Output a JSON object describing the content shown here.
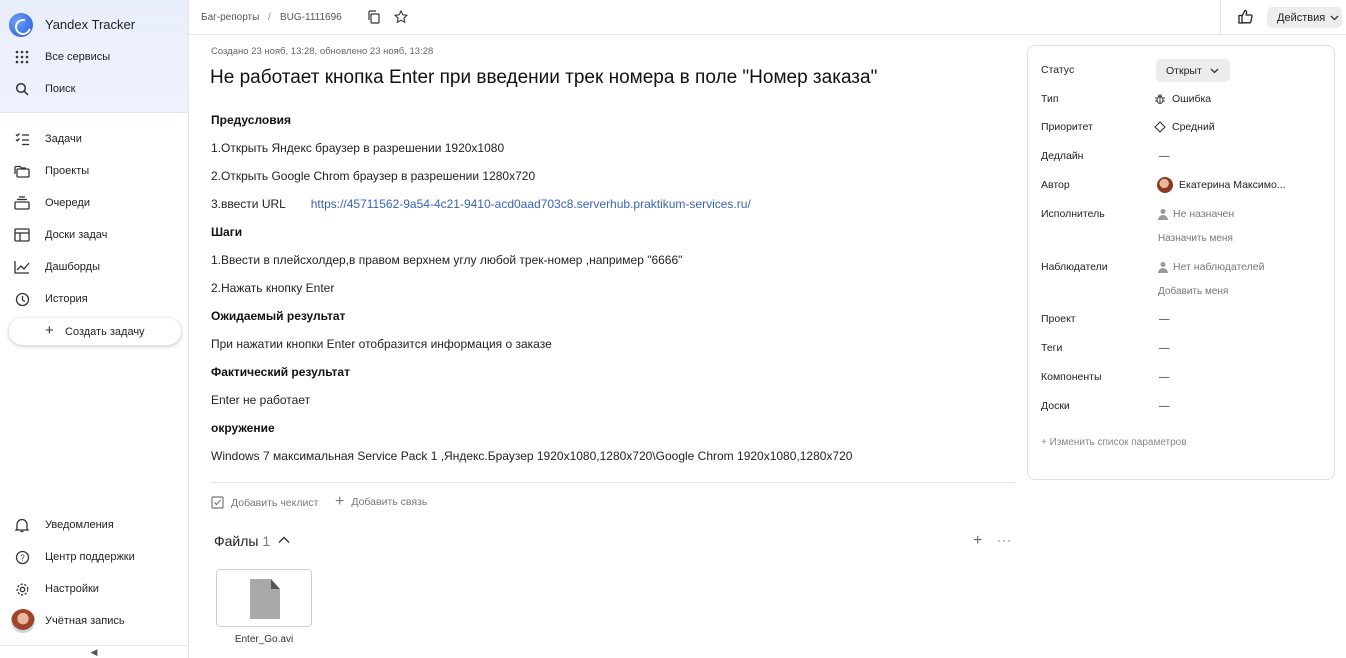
{
  "sidebar": {
    "brand": "Yandex Tracker",
    "top_items": [
      {
        "label": "Все сервисы",
        "icon": "grid-icon"
      },
      {
        "label": "Поиск",
        "icon": "search-icon"
      }
    ],
    "nav_items": [
      {
        "label": "Задачи",
        "icon": "tasks-icon"
      },
      {
        "label": "Проекты",
        "icon": "projects-icon"
      },
      {
        "label": "Очереди",
        "icon": "queues-icon"
      },
      {
        "label": "Доски задач",
        "icon": "boards-icon"
      },
      {
        "label": "Дашборды",
        "icon": "dashboards-icon"
      },
      {
        "label": "История",
        "icon": "history-icon"
      }
    ],
    "create_task": "Создать задачу",
    "bottom_items": [
      {
        "label": "Уведомления",
        "icon": "bell-icon"
      },
      {
        "label": "Центр поддержки",
        "icon": "help-icon"
      },
      {
        "label": "Настройки",
        "icon": "gear-icon"
      },
      {
        "label": "Учётная запись",
        "icon": "avatar"
      }
    ],
    "collapse_glyph": "◀"
  },
  "header": {
    "breadcrumb_queue": "Баг-репорты",
    "breadcrumb_sep": "/",
    "breadcrumb_key": "BUG-1111696",
    "actions_label": "Действия"
  },
  "issue": {
    "meta": "Создано 23 нояб, 13:28, обновлено 23 нояб, 13:28",
    "title": "Не работает кнопка Enter при введении трек номера в поле \"Номер заказа\"",
    "description": {
      "h_pre": "Предусловия",
      "pre_1": "1.Открыть Яндекс браузер в разрешении 1920х1080",
      "pre_2": "2.Открыть Google Chrom браузер в разрешении 1280х720",
      "pre_3_text": "3.ввести URL",
      "pre_3_link": "https://45711562-9a54-4c21-9410-acd0aad703c8.serverhub.praktikum-services.ru/",
      "h_steps": "Шаги",
      "step_1": "1.Ввести в плейсхолдер,в правом верхнем углу любой трек-номер ,например \"6666\"",
      "step_2": "2.Нажать кнопку Enter",
      "h_expected": "Ожидаемый результат",
      "expected": "При нажатии кнопки Enter отобразится информация о заказе",
      "h_actual": "Фактический результат",
      "actual": "Enter не работает",
      "h_env": "окружение",
      "env": "Windows 7 максимальная Service Pack 1 ,Яндекс.Браузер 1920х1080,1280х720\\Google Chrom 1920х1080,1280х720"
    },
    "add_checklist": "Добавить чеклист",
    "add_link": "Добавить связь",
    "files_title": "Файлы",
    "files_count": "1",
    "files": [
      {
        "name": "Enter_Go.avi"
      }
    ]
  },
  "panel": {
    "status_label": "Статус",
    "status_value": "Открыт",
    "type_label": "Тип",
    "type_value": "Ошибка",
    "priority_label": "Приоритет",
    "priority_value": "Средний",
    "deadline_label": "Дедлайн",
    "deadline_value": "—",
    "author_label": "Автор",
    "author_value": "Екатерина Максимо...",
    "assignee_label": "Исполнитель",
    "assignee_value": "Не назначен",
    "assign_me": "Назначить меня",
    "followers_label": "Наблюдатели",
    "followers_value": "Нет наблюдателей",
    "add_me": "Добавить меня",
    "project_label": "Проект",
    "project_value": "—",
    "tags_label": "Теги",
    "tags_value": "—",
    "components_label": "Компоненты",
    "components_value": "—",
    "boards_label": "Доски",
    "boards_value": "—",
    "edit_params": "Изменить список параметров"
  }
}
